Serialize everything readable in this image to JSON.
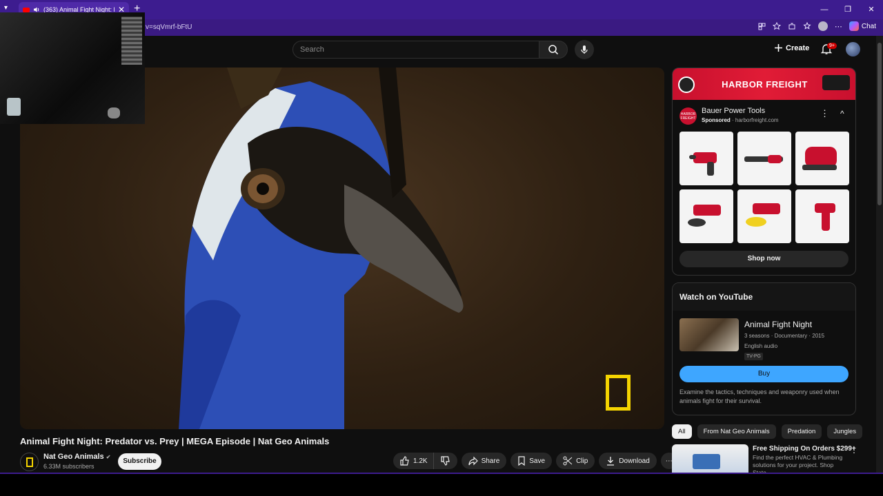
{
  "browser": {
    "tab_title": "(363) Animal Fight Night: Pred",
    "url_fragment": "v=sqVmrf-bFtU",
    "chat_label": "Chat",
    "new_tab": "+",
    "close_glyph": "✕",
    "minimize_glyph": "—",
    "restore_glyph": "❐",
    "win_close_glyph": "✕"
  },
  "header": {
    "search_placeholder": "Search",
    "create_label": "Create",
    "notification_badge": "9+"
  },
  "video": {
    "title": "Animal Fight Night: Predator vs. Prey | MEGA Episode | Nat Geo Animals",
    "channel_name": "Nat Geo Animals",
    "verified_glyph": "✔",
    "subscribers": "6.33M subscribers",
    "subscribe_label": "Subscribe",
    "like_count": "1.2K",
    "share_label": "Share",
    "save_label": "Save",
    "clip_label": "Clip",
    "download_label": "Download",
    "more_glyph": "⋯"
  },
  "ad": {
    "banner_brand": "HARBOR FREIGHT",
    "logo_text": "HARBOR FREIGHT",
    "advertiser": "Bauer Power Tools",
    "sponsored": "Sponsored",
    "domain": "· harborfreight.com",
    "menu_glyph": "⋮",
    "collapse_glyph": "^",
    "shop_label": "Shop now",
    "accent": "#c8102e"
  },
  "watch": {
    "heading": "Watch on YouTube",
    "show_title": "Animal Fight Night",
    "meta": "3 seasons · Documentary · 2015",
    "audio": "English audio",
    "rating": "TV-PG",
    "buy_label": "Buy",
    "description": "Examine the tactics, techniques and weaponry used when animals fight for their survival.",
    "buy_color": "#3ea6ff"
  },
  "chips": [
    "All",
    "From Nat Geo Animals",
    "Predation",
    "Jungles"
  ],
  "next_ad": {
    "title": "Free Shipping On Orders $299+",
    "description": "Find the perfect HVAC & Plumbing solutions for your project. Shop State",
    "menu_glyph": "⋮"
  }
}
